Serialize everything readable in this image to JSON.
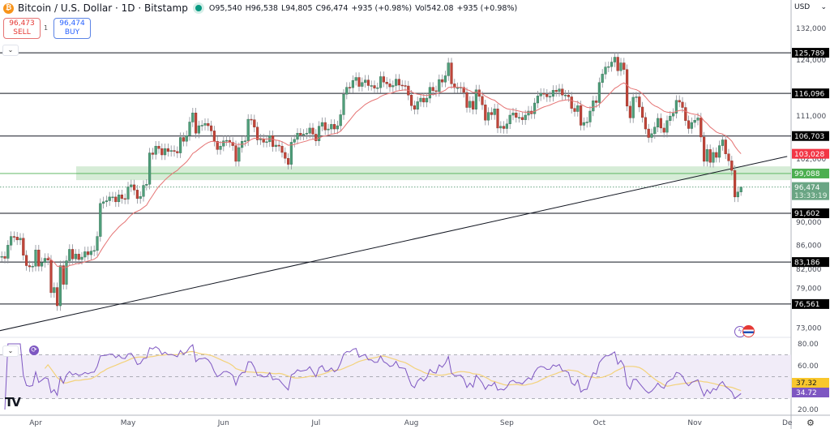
{
  "header": {
    "coin_icon": "bitcoin-icon",
    "symbol_title": "Bitcoin / U.S. Dollar · 1D · Bitstamp",
    "open": "O95,540",
    "high": "H96,538",
    "low": "L94,805",
    "close": "C96,474",
    "change": "+935 (+0.98%)",
    "volume": "Vol542.08",
    "volume_change": "+935 (+0.98%)"
  },
  "trade": {
    "sell_price": "96,473",
    "sell_label": "SELL",
    "quantity": "1",
    "buy_price": "96,474",
    "buy_label": "BUY"
  },
  "axis": {
    "currency": "USD",
    "collapse_glyph": "⌄",
    "settings_glyph": "⚙"
  },
  "colors": {
    "up": "#4f9e7a",
    "down": "#c0453a",
    "ema": "#e57373",
    "zone": "#c8e6c9",
    "rsi": "#7e57c2",
    "rsi_ma": "#f3d27a",
    "level": "#131722",
    "ema_label": "#f23645",
    "zone_label": "#4caf50",
    "price_label": "#6aa584"
  },
  "chart_data": {
    "type": "candlestick",
    "title": "Bitcoin / U.S. Dollar · 1D · Bitstamp",
    "y_scale": "log",
    "grid": false,
    "start_date": "2025-03-21",
    "interval": "1D",
    "closes": [
      84100,
      83800,
      86000,
      87500,
      87400,
      86900,
      87200,
      84300,
      82600,
      82400,
      82500,
      85200,
      82500,
      83100,
      83800,
      83500,
      78300,
      79100,
      76300,
      82600,
      79600,
      83400,
      85300,
      83700,
      84500,
      83600,
      84000,
      84900,
      84400,
      85000,
      85100,
      87500,
      93400,
      93700,
      93900,
      94600,
      94600,
      93700,
      95000,
      94300,
      94200,
      96500,
      96900,
      95900,
      94300,
      94700,
      96800,
      97000,
      103200,
      102900,
      104600,
      104100,
      102800,
      104100,
      103500,
      103700,
      103500,
      103200,
      106400,
      105600,
      106800,
      109700,
      111700,
      107300,
      108900,
      109000,
      109400,
      108900,
      107800,
      105600,
      103900,
      104600,
      105700,
      105800,
      105400,
      104700,
      101500,
      104300,
      105600,
      105700,
      110300,
      110200,
      108600,
      105900,
      106100,
      105400,
      105500,
      106800,
      104500,
      104800,
      104600,
      103300,
      102100,
      100900,
      105400,
      106000,
      107300,
      106900,
      107100,
      107300,
      108400,
      107100,
      105700,
      108800,
      109600,
      108000,
      108200,
      109200,
      108200,
      108900,
      111300,
      115900,
      117500,
      117400,
      119100,
      119800,
      117700,
      118600,
      119200,
      117900,
      117900,
      117300,
      117400,
      120000,
      118700,
      118300,
      117600,
      117900,
      119400,
      118000,
      117900,
      117800,
      115700,
      113300,
      112500,
      114200,
      115000,
      114100,
      115000,
      117500,
      116700,
      116500,
      119300,
      118700,
      120200,
      123300,
      118300,
      117400,
      117400,
      117500,
      116300,
      112900,
      114300,
      112500,
      116900,
      115400,
      113500,
      110100,
      111800,
      111300,
      112600,
      108400,
      108800,
      108300,
      109300,
      111200,
      111700,
      110700,
      110700,
      110200,
      111200,
      112100,
      111500,
      113900,
      115500,
      116100,
      115900,
      115300,
      115400,
      116800,
      116500,
      117100,
      115700,
      115700,
      115300,
      112700,
      112000,
      113300,
      109000,
      109600,
      109700,
      112100,
      114400,
      114000,
      118600,
      120600,
      122300,
      122400,
      123500,
      124700,
      121400,
      123300,
      121700,
      113200,
      110600,
      115200,
      115300,
      113000,
      110700,
      108200,
      106400,
      107200,
      108600,
      110500,
      108400,
      107500,
      110000,
      111000,
      111600,
      114500,
      114100,
      112900,
      110000,
      108300,
      109600,
      110100,
      110600,
      106500,
      101500,
      103900,
      101300,
      103300,
      102300,
      104700,
      105900,
      103000,
      101600,
      99700,
      94600,
      95540,
      96474
    ],
    "last_candle": {
      "open": 95540,
      "high": 96538,
      "low": 94805,
      "close": 96474
    },
    "ema_period": 20,
    "ema_last_label": "103,028",
    "current_price_label": "96,474",
    "countdown": "13:33:19",
    "levels": [
      {
        "value": 125789,
        "label": "125,789"
      },
      {
        "value": 116096,
        "label": "116,096"
      },
      {
        "value": 106703,
        "label": "106,703"
      },
      {
        "value": 91602,
        "label": "91,602"
      },
      {
        "value": 83186,
        "label": "83,186"
      },
      {
        "value": 76561,
        "label": "76,561"
      }
    ],
    "support_zone": {
      "low": 97800,
      "high": 100500,
      "mid": 99088,
      "label": "99,088"
    },
    "trendline": [
      {
        "date": "2025-03-20",
        "price": 72600
      },
      {
        "date": "2025-12-01",
        "price": 102500
      }
    ],
    "y_ticks": [
      {
        "value": 132000,
        "label": "132,000"
      },
      {
        "value": 124000,
        "label": "124,000"
      },
      {
        "value": 111000,
        "label": "111,000"
      },
      {
        "value": 102000,
        "label": "102,000"
      },
      {
        "value": 90000,
        "label": "90,000"
      },
      {
        "value": 86000,
        "label": "86,000"
      },
      {
        "value": 82000,
        "label": "82,000"
      },
      {
        "value": 79000,
        "label": "79,000"
      },
      {
        "value": 73000,
        "label": "73,000"
      }
    ],
    "x_ticks": [
      {
        "date": "2025-04-01",
        "label": "Apr"
      },
      {
        "date": "2025-05-01",
        "label": "May"
      },
      {
        "date": "2025-06-01",
        "label": "Jun"
      },
      {
        "date": "2025-07-01",
        "label": "Jul"
      },
      {
        "date": "2025-08-01",
        "label": "Aug"
      },
      {
        "date": "2025-09-01",
        "label": "Sep"
      },
      {
        "date": "2025-10-01",
        "label": "Oct"
      },
      {
        "date": "2025-11-01",
        "label": "Nov"
      },
      {
        "date": "2025-12-01",
        "label": "De"
      }
    ],
    "rsi": {
      "period": 14,
      "ma_period": 14,
      "ylim": [
        20,
        80
      ],
      "bands": [
        70,
        50,
        30
      ],
      "y_ticks": [
        {
          "value": 80,
          "label": "80.00"
        },
        {
          "value": 60,
          "label": "60.00"
        },
        {
          "value": 20,
          "label": "20.00"
        }
      ],
      "ma_last_label": "37.32",
      "rsi_last_label": "34.72"
    }
  }
}
